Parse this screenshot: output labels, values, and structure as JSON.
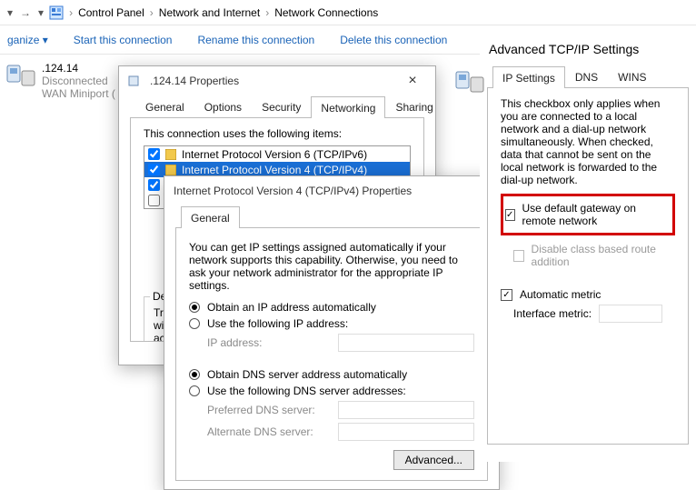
{
  "breadcrumb": {
    "items": [
      "Control Panel",
      "Network and Internet",
      "Network Connections"
    ]
  },
  "cmdbar": {
    "organize": "ganize",
    "start": "Start this connection",
    "rename": "Rename this connection",
    "delete": "Delete this connection"
  },
  "adapter": {
    "name": ".124.14",
    "status": "Disconnected",
    "device": "WAN Miniport ("
  },
  "props": {
    "title": ".124.14 Properties",
    "tabs": [
      "General",
      "Options",
      "Security",
      "Networking",
      "Sharing"
    ],
    "uses_label": "This connection uses the following items:",
    "items": [
      {
        "checked": true,
        "label": "Internet Protocol Version 6 (TCP/IPv6)"
      },
      {
        "checked": true,
        "label": "Internet Protocol Version 4 (TCP/IPv4)",
        "selected": true
      },
      {
        "checked": true,
        "label": ""
      },
      {
        "checked": false,
        "label": ""
      }
    ],
    "desc_heading": "Desc",
    "desc_body1": "Tran",
    "desc_body2": "wide",
    "desc_body3": "acro"
  },
  "ipv4": {
    "title": "Internet Protocol Version 4 (TCP/IPv4) Properties",
    "tab": "General",
    "intro": "You can get IP settings assigned automatically if your network supports this capability. Otherwise, you need to ask your network administrator for the appropriate IP settings.",
    "r_auto_ip": "Obtain an IP address automatically",
    "r_manual_ip": "Use the following IP address:",
    "ip_label": "IP address:",
    "r_auto_dns": "Obtain DNS server address automatically",
    "r_manual_dns": "Use the following DNS server addresses:",
    "pref_dns": "Preferred DNS server:",
    "alt_dns": "Alternate DNS server:",
    "advanced_btn": "Advanced..."
  },
  "adv": {
    "title": "Advanced TCP/IP Settings",
    "tabs": [
      "IP Settings",
      "DNS",
      "WINS"
    ],
    "para": "This checkbox only applies when you are connected to a local network and a dial-up network simultaneously. When checked, data that cannot be sent on the local network is forwarded to the dial-up network.",
    "gw": "Use default gateway on remote network",
    "route": "Disable class based route addition",
    "metric": "Automatic metric",
    "iface_metric": "Interface metric:"
  }
}
